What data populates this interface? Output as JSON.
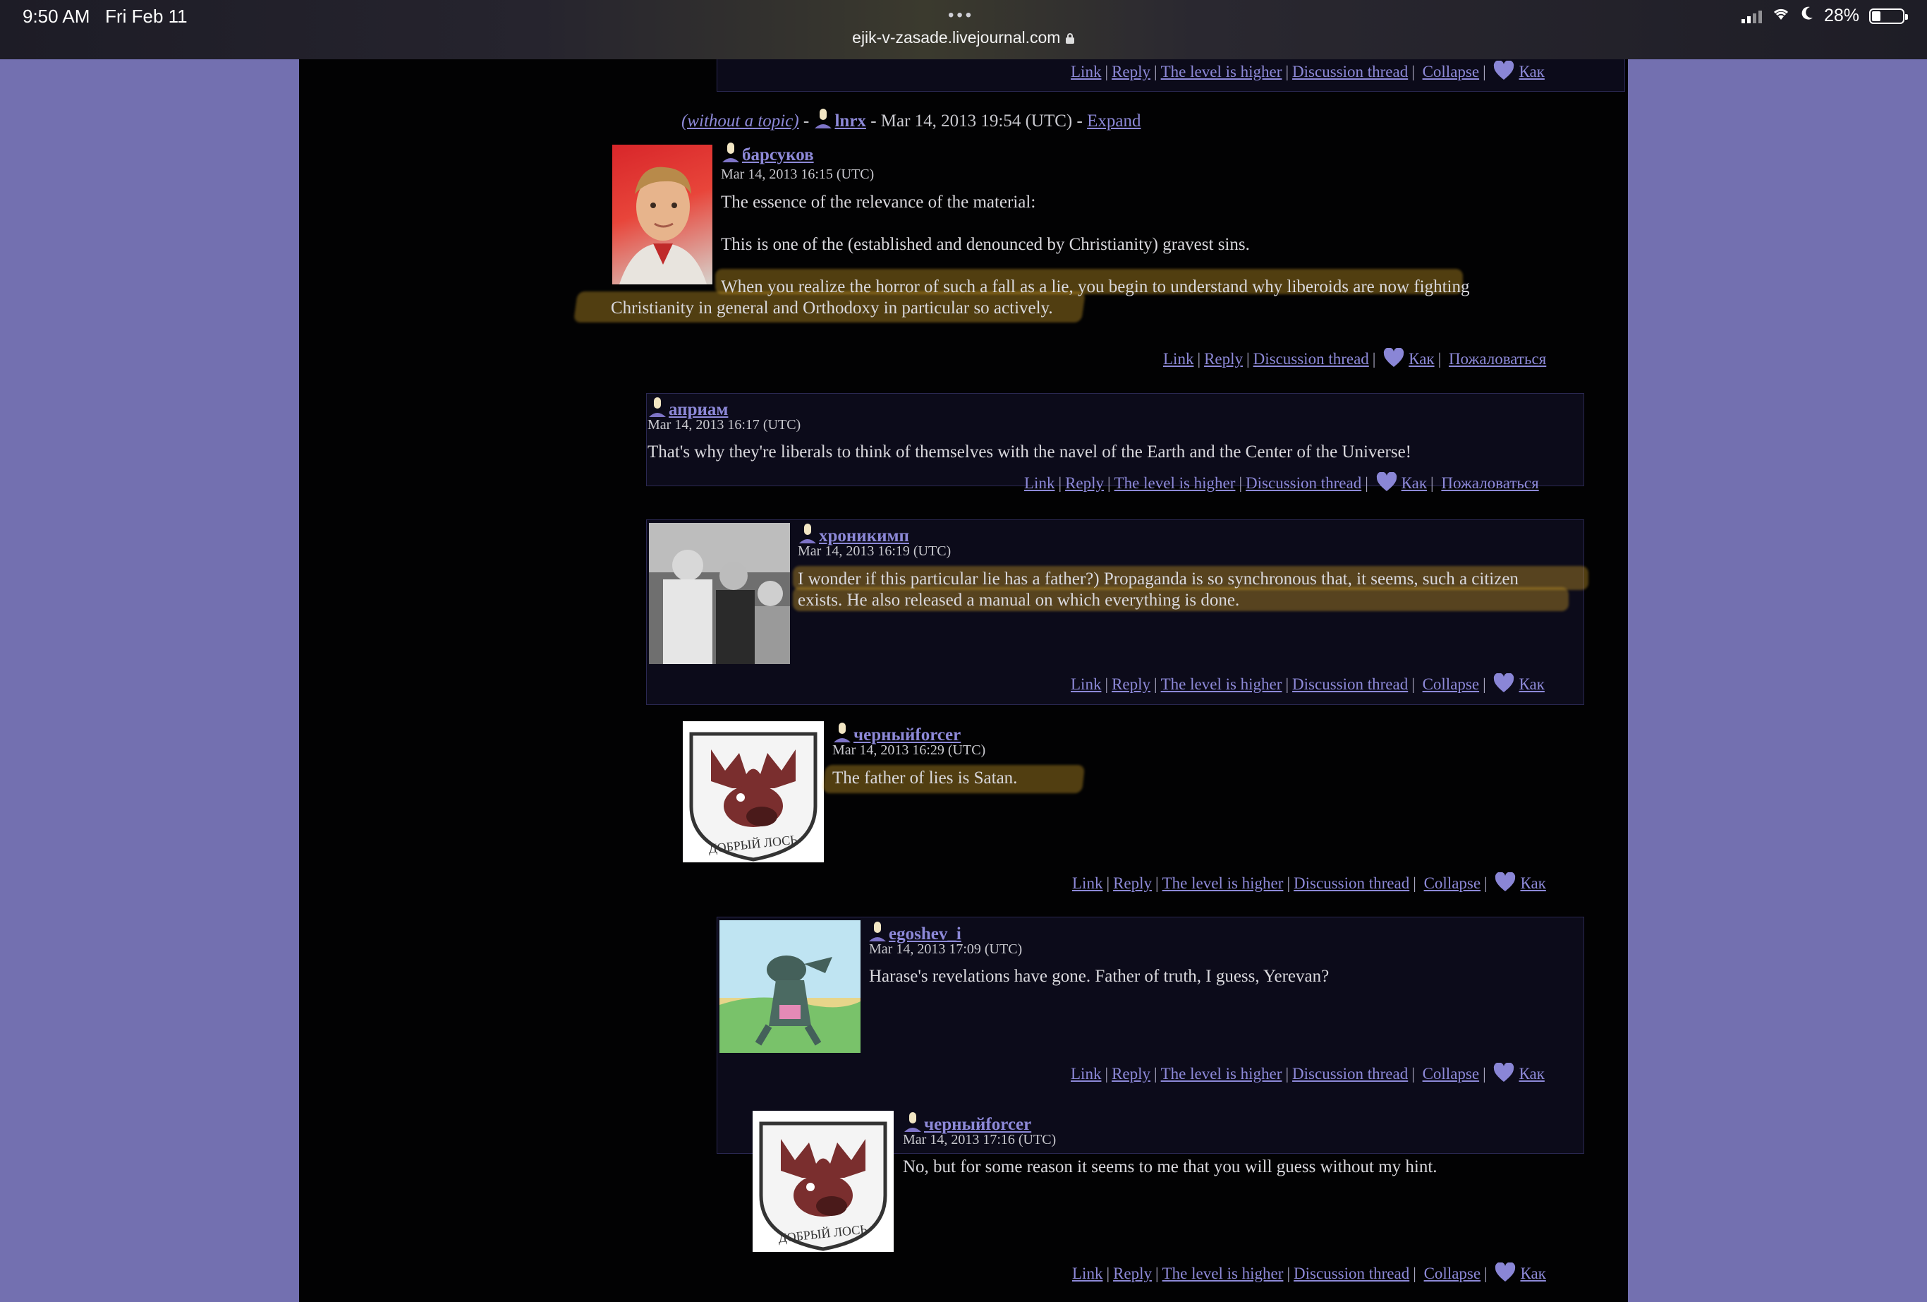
{
  "status": {
    "time": "9:50 AM",
    "date": "Fri Feb 11",
    "battery": "28%",
    "battery_level": 0.28,
    "dots": "•••"
  },
  "browser": {
    "url": "ejik-v-zasade.livejournal.com"
  },
  "links": {
    "link": "Link",
    "reply": "Reply",
    "level_higher": "The level is higher",
    "discussion": "Discussion thread",
    "collapse": "Collapse",
    "like": "Как",
    "complain": "Пожаловаться",
    "expand": "Expand"
  },
  "collapsed": {
    "topic": "(without a topic)",
    "sep1": "-",
    "user": "lnrx",
    "sep2": "-",
    "meta": "Mar 14, 2013 19:54 (UTC)",
    "sep3": "-"
  },
  "comments": [
    {
      "user": "барсуков",
      "date": "Mar 14, 2013 16:15 (UTC)",
      "p1": "The essence of the relevance of the material:",
      "p2": "This is one of the (established and denounced by Christianity) gravest sins.",
      "p3a": "When you realize the horror of such a fall as a lie, you begin to understand why liberoids are now fighting",
      "p3b": "Christianity in general and Orthodoxy in particular so actively."
    },
    {
      "user": "априам",
      "date": "Mar 14, 2013 16:17 (UTC)",
      "text": "That's why they're liberals to think of themselves with the navel of the Earth and the Center of the Universe!"
    },
    {
      "user": "хроникимп",
      "date": "Mar 14, 2013 16:19 (UTC)",
      "text1": "I wonder if this particular lie has a father?) Propaganda is so synchronous that, it seems, such a citizen",
      "text2": "exists. He also released a manual on which everything is done."
    },
    {
      "user": "черныйforcer",
      "date": "Mar 14, 2013 16:29 (UTC)",
      "text": "The father of lies is Satan."
    },
    {
      "user": "egoshev_i",
      "date": "Mar 14, 2013 17:09 (UTC)",
      "text": "Harase's revelations have gone. Father of truth, I guess, Yerevan?"
    },
    {
      "user": "черныйforcer",
      "date": "Mar 14, 2013 17:16 (UTC)",
      "text": "No, but for some reason it seems to me that you will guess without my hint."
    }
  ],
  "avatar_text": {
    "moose": "ДОБРЫЙ ЛОСЬ"
  },
  "colors": {
    "page_bg": "#7370b0",
    "content_bg": "#020203",
    "link": "#8d89d8",
    "highlight": "#c99a2a"
  }
}
